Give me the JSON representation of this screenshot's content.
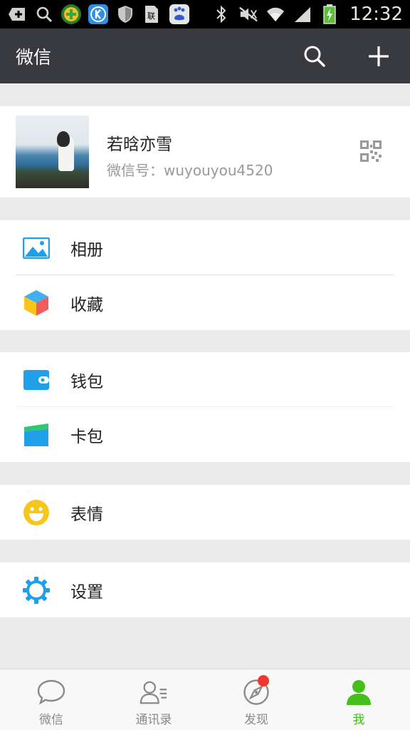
{
  "status_bar": {
    "time": "12:32",
    "left_icons": [
      "add-square-icon",
      "search-icon",
      "plus-badge-app-icon",
      "k-app-icon",
      "shield-icon",
      "sim-card-icon",
      "baidu-icon"
    ],
    "right_icons": [
      "bluetooth-icon",
      "mute-icon",
      "wifi-icon",
      "signal-icon",
      "battery-charging-icon"
    ]
  },
  "header": {
    "title": "微信"
  },
  "profile": {
    "name": "若晗亦雪",
    "wechat_id": "微信号：wuyouyou4520"
  },
  "menu": {
    "album": "相册",
    "favorites": "收藏",
    "wallet": "钱包",
    "cards": "卡包",
    "stickers": "表情",
    "settings": "设置"
  },
  "tabs": [
    {
      "label": "微信",
      "icon": "chat-bubble-icon",
      "active": false
    },
    {
      "label": "通讯录",
      "icon": "contacts-icon",
      "active": false
    },
    {
      "label": "发现",
      "icon": "compass-icon",
      "active": false,
      "badge": true
    },
    {
      "label": "我",
      "icon": "person-icon",
      "active": true
    }
  ],
  "colors": {
    "header_bg": "#393a3f",
    "accent_green": "#45c01a",
    "icon_blue": "#20a0e8",
    "badge_red": "#f43530",
    "page_bg": "#ebebeb"
  }
}
